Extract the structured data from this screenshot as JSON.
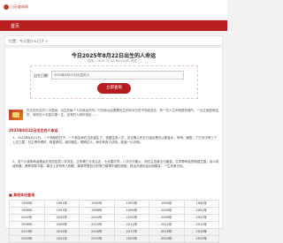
{
  "site": {
    "name": "日历查询网"
  },
  "nav": {
    "home": "首页"
  },
  "breadcrumb": {
    "text": "位置：今天是什么日子 >"
  },
  "article": {
    "title": "今日2025年8月22日出生的人命运",
    "meta": "时间：2025-01-21 00:00:00  浏览："
  },
  "query": {
    "label": "出生日期：",
    "value": "2025年8月22日出生的人",
    "button": "立即查询"
  },
  "intro": {
    "text": "在农历的农历八字里面，出生的每个人的命运不同。它的命运会跟着出生的年月日时不同而变化，有一些人生来就很有福气，一出生家庭就富贵，而有的人可能平庸一生，还有的人刚好相反……"
  },
  "section1": {
    "title": "2025年8月22日出生的人命运",
    "paragraphs": [
      "1、2025年8月22日，一个特别的日子，一个新生命在当天诞生了。依据生辰八字，这位婴儿的五行组合是戊火配金木，甲申、庚辰、丁巳天中有三个上吉之星，日主得令得时，财星得位，官印相生，聪明过人，命中有贵人扶持，前途一片光明。",
      "2、这个小孩的命运是由先天的生辰八字决定，正所谓三分天注定，七分靠打拼。八字五行属火，而日主自身五行属金，生来带有金的刚强正直，待人真诚热情，具有领导才能，事业上多有贵人相助，能够凭借自己的努力取得不错的成就，财运方面也会比较稳定，一生衣食无忧。"
    ]
  },
  "section2": {
    "title": "■ 其他年份查询",
    "years": [
      [
        "1990年",
        "1991年",
        "1992年",
        "1993年",
        "1994年",
        "1995年"
      ],
      [
        "1996年",
        "1997年",
        "1998年",
        "1999年",
        "2000年",
        "2001年"
      ],
      [
        "2002年",
        "2003年",
        "2004年",
        "2005年",
        "2006年",
        "2007年"
      ],
      [
        "2008年",
        "2009年",
        "2010年",
        "2011年",
        "2012年",
        "2013年"
      ],
      [
        "2014年",
        "2015年",
        "2016年",
        "2017年",
        "2018年",
        "2019年"
      ],
      [
        "2020年",
        "2021年",
        "2022年",
        "2023年",
        "2024年",
        "2025年"
      ]
    ]
  },
  "colors": {
    "brand": "#b41e1e",
    "background": "#f2f2f2"
  }
}
